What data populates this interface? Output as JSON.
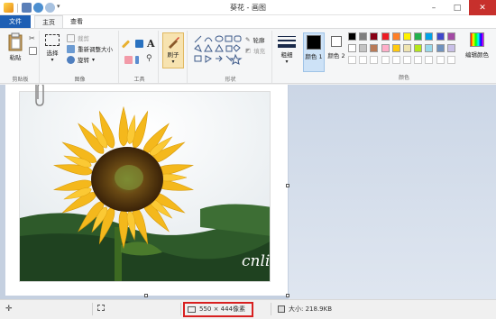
{
  "window": {
    "title": "葵花 - 画图"
  },
  "tabs": [
    {
      "label": "文件"
    },
    {
      "label": "主页"
    },
    {
      "label": "查看"
    }
  ],
  "ribbon": {
    "clipboard": {
      "paste": "粘贴",
      "label": "剪贴板"
    },
    "image": {
      "select": "选择",
      "crop": "裁剪",
      "resize": "重新调整大小",
      "rotate": "旋转",
      "label": "图像"
    },
    "tools": {
      "label": "工具"
    },
    "brush": {
      "label": "刷子"
    },
    "shapes": {
      "outline": "轮廓",
      "fill": "填充",
      "label": "形状"
    },
    "size": {
      "label": "粗细"
    },
    "color1": {
      "label": "颜色 1"
    },
    "color2": {
      "label": "颜色 2"
    },
    "colors": {
      "label": "颜色",
      "edit": "编辑颜色",
      "row1": [
        "#000000",
        "#7f7f7f",
        "#880015",
        "#ed1c24",
        "#ff7f27",
        "#fff200",
        "#22b14c",
        "#00a2e8",
        "#3f48cc",
        "#a349a4"
      ],
      "row2": [
        "#ffffff",
        "#c3c3c3",
        "#b97a57",
        "#ffaec9",
        "#ffc90e",
        "#efe4b0",
        "#b5e61d",
        "#99d9ea",
        "#7092be",
        "#c8bfe7"
      ],
      "primary": "#000000",
      "secondary": "#ffffff"
    }
  },
  "canvas": {
    "signature": "cnli"
  },
  "status": {
    "dimensions": "550 × 444像素",
    "filesize": "大小: 218.9KB"
  }
}
